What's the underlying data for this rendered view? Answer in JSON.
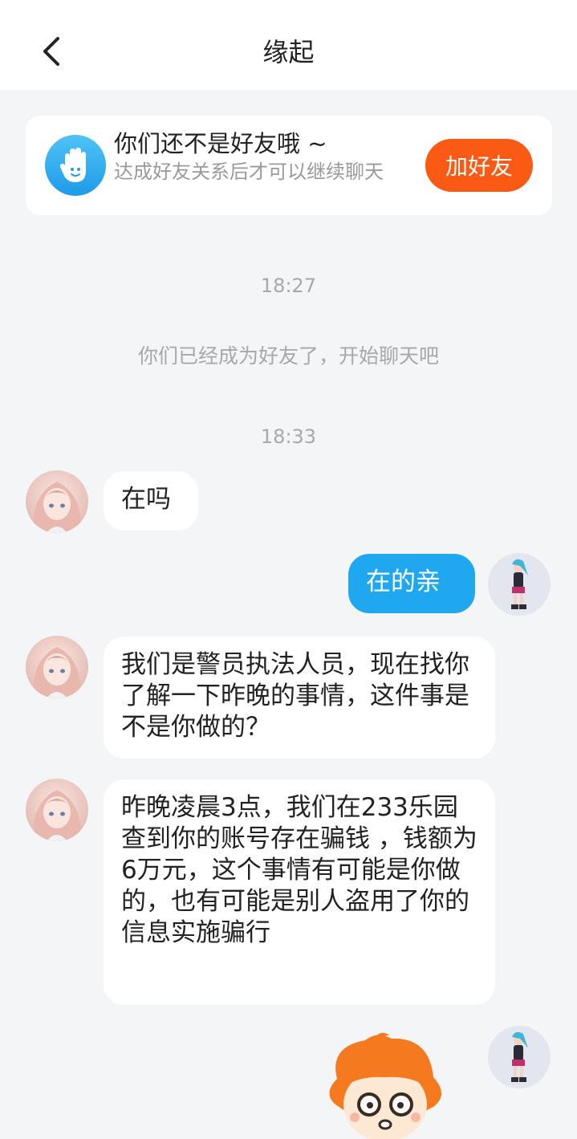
{
  "header": {
    "title": "缘起"
  },
  "friend_notice": {
    "title": "你们还不是好友哦 ~",
    "subtitle": "达成好友关系后才可以继续聊天",
    "button_label": "加好友",
    "button_color": "#fa5a14"
  },
  "chat": {
    "timestamps": [
      "18:27",
      "18:33"
    ],
    "system_message": "你们已经成为好友了，开始聊天吧",
    "messages": [
      {
        "sender": "other",
        "text": "在吗"
      },
      {
        "sender": "me",
        "text": "在的亲"
      },
      {
        "sender": "other",
        "text": "我们是警员执法人员，现在找你了解一下昨晚的事情，这件事是不是你做的？"
      },
      {
        "sender": "other",
        "text": "昨晚凌晨3点，我们在233乐园查到你的账号存在骗钱 ，钱额为6万元，这个事情有可能是你做的，也有可能是别人盗用了你的信息实施骗行"
      }
    ]
  },
  "colors": {
    "my_bubble": "#1fa8f0",
    "background": "#f4f5f7"
  }
}
